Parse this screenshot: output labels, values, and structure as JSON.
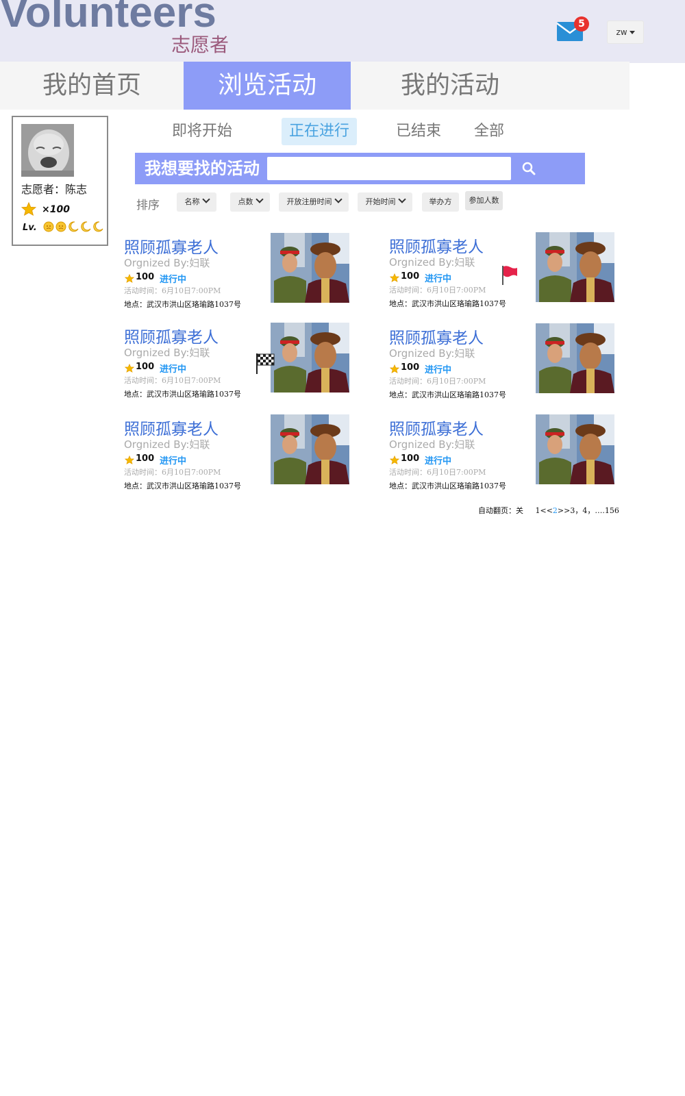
{
  "header": {
    "brand_en": "Volunteers",
    "brand_cn": "志愿者",
    "mail_count": "5",
    "lang": "zw"
  },
  "nav": {
    "tabs": [
      {
        "label": "我的首页"
      },
      {
        "label": "浏览活动",
        "active": true
      },
      {
        "label": "我的活动"
      }
    ]
  },
  "profile": {
    "name_line": "志愿者：陈志",
    "points": "×100",
    "level_label": "Lv."
  },
  "subtabs": [
    {
      "label": "即将开始"
    },
    {
      "label": "正在进行",
      "active": true
    },
    {
      "label": "已结束"
    },
    {
      "label": "全部"
    }
  ],
  "search": {
    "label": "我想要找的活动",
    "value": "",
    "placeholder": ""
  },
  "sort": {
    "label": "排序",
    "buttons": [
      "名称",
      "点数",
      "开放注册时间",
      "开始时间",
      "举办方",
      "参加人数"
    ]
  },
  "activities": [
    {
      "title": "照顾孤寡老人",
      "org": "Orgnized By:妇联",
      "points": "100",
      "status": "进行中",
      "time": "活动时间：6月10日7:00PM",
      "place": "地点：武汉市洪山区珞瑜路1037号"
    },
    {
      "title": "照顾孤寡老人",
      "org": "Orgnized By:妇联",
      "points": "100",
      "status": "进行中",
      "time": "活动时间：6月10日7:00PM",
      "place": "地点：武汉市洪山区珞瑜路1037号"
    },
    {
      "title": "照顾孤寡老人",
      "org": "Orgnized By:妇联",
      "points": "100",
      "status": "进行中",
      "time": "活动时间：6月10日7:00PM",
      "place": "地点：武汉市洪山区珞瑜路1037号"
    },
    {
      "title": "照顾孤寡老人",
      "org": "Orgnized By:妇联",
      "points": "100",
      "status": "进行中",
      "time": "活动时间：6月10日7:00PM",
      "place": "地点：武汉市洪山区珞瑜路1037号"
    },
    {
      "title": "照顾孤寡老人",
      "org": "Orgnized By:妇联",
      "points": "100",
      "status": "进行中",
      "time": "活动时间：6月10日7:00PM",
      "place": "地点：武汉市洪山区珞瑜路1037号"
    },
    {
      "title": "照顾孤寡老人",
      "org": "Orgnized By:妇联",
      "points": "100",
      "status": "进行中",
      "time": "活动时间：6月10日7:00PM",
      "place": "地点：武汉市洪山区珞瑜路1037号"
    }
  ],
  "pager": {
    "auto_label": "自动翻页：关",
    "first": "1",
    "prev": "<<",
    "current": "2",
    "next": ">>",
    "rest": "3，4，….156"
  },
  "colors": {
    "accent": "#8d9cf7",
    "title_blue": "#3d6fd6",
    "status_blue": "#2196f3",
    "badge_red": "#e8322e"
  },
  "icons": [
    "mail-icon",
    "search-icon",
    "star-icon",
    "red-flag-icon",
    "checkered-flag-icon",
    "sun-icon",
    "moon-icon"
  ]
}
